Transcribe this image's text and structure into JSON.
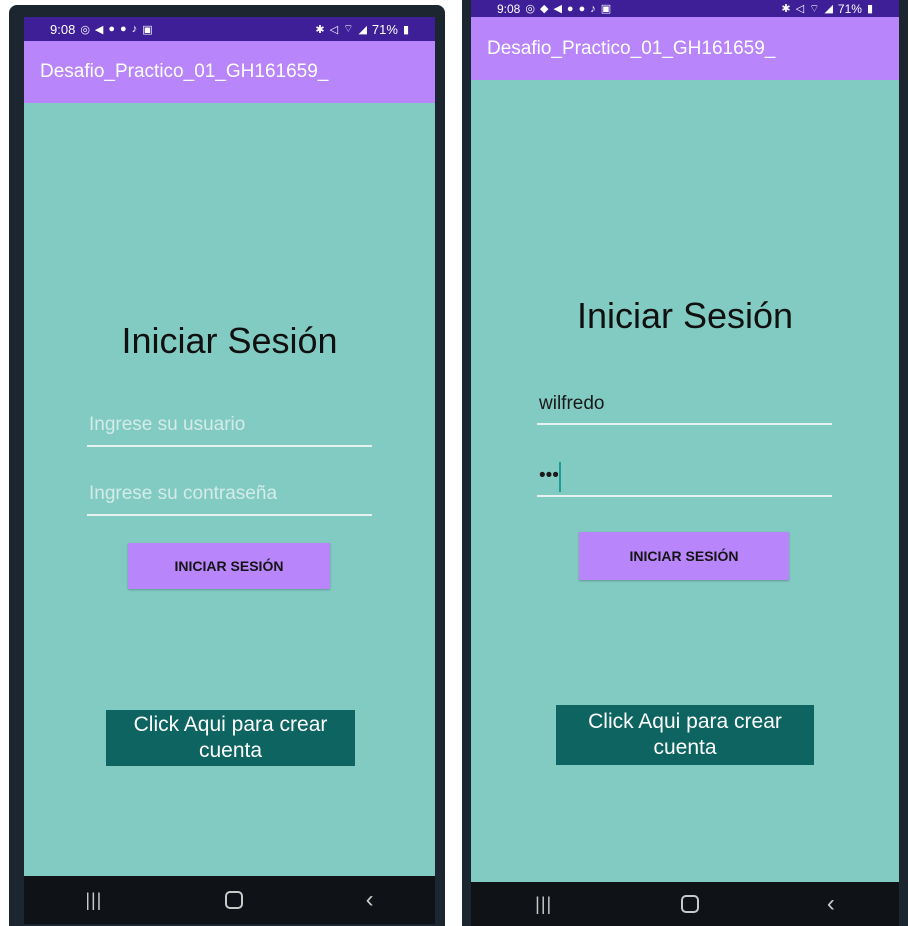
{
  "status_bar": {
    "time": "9:08",
    "battery": "71%"
  },
  "app": {
    "title": "Desafio_Practico_01_GH161659_"
  },
  "login": {
    "heading": "Iniciar Sesión",
    "user_placeholder": "Ingrese su usuario",
    "password_placeholder": "Ingrese su contraseña",
    "submit_label": "INICIAR SESIÓN",
    "create_account_label": "Click Aqui para crear cuenta"
  },
  "right_screen": {
    "user_value": "wilfredo",
    "password_value": "•••"
  },
  "colors": {
    "background": "#82cbc3",
    "appbar": "#b885fb",
    "statusbar": "#3e1f98",
    "create_button": "#0d6460"
  },
  "icons": [
    "whatsapp-icon",
    "send-icon",
    "facebook-icon",
    "tiktok-icon",
    "gallery-icon",
    "wifi-icon",
    "signal-icon",
    "battery-icon",
    "recent-apps-icon",
    "home-icon",
    "back-icon"
  ]
}
